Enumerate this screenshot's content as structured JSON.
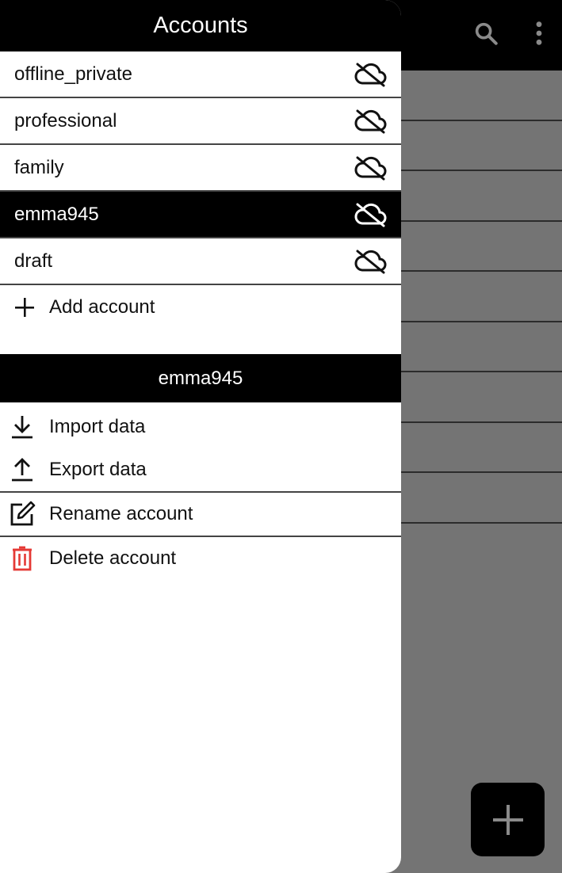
{
  "drawer": {
    "title": "Accounts",
    "accounts": [
      {
        "name": "offline_private",
        "selected": false,
        "status_icon": "cloud-off-icon"
      },
      {
        "name": "professional",
        "selected": false,
        "status_icon": "cloud-off-icon"
      },
      {
        "name": "family",
        "selected": false,
        "status_icon": "cloud-off-icon"
      },
      {
        "name": "emma945",
        "selected": true,
        "status_icon": "cloud-off-icon"
      },
      {
        "name": "draft",
        "selected": false,
        "status_icon": "cloud-off-icon"
      }
    ],
    "add_account_label": "Add account",
    "current_account": "emma945",
    "actions": {
      "import": "Import data",
      "export": "Export data",
      "rename": "Rename account",
      "delete": "Delete account"
    }
  },
  "topbar": {
    "icons": [
      "search-icon",
      "more-vert-icon"
    ]
  },
  "fab": {
    "icon": "plus-icon"
  },
  "colors": {
    "header_bg": "#000000",
    "selected_bg": "#000000",
    "scrim": "#747474",
    "delete_red": "#e53935"
  }
}
